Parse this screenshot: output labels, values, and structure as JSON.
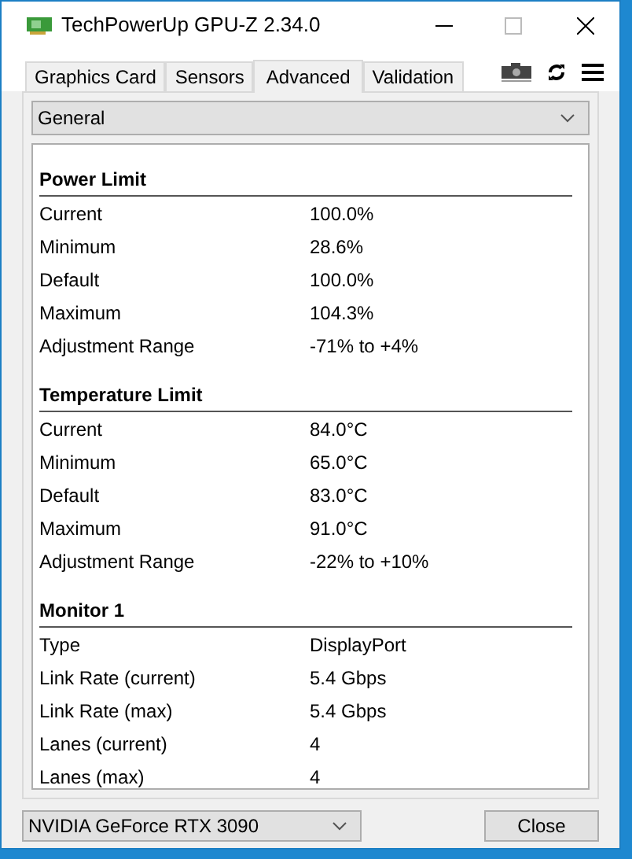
{
  "window": {
    "title": "TechPowerUp GPU-Z 2.34.0"
  },
  "tabs": [
    {
      "label": "Graphics Card",
      "selected": false
    },
    {
      "label": "Sensors",
      "selected": false
    },
    {
      "label": "Advanced",
      "selected": true
    },
    {
      "label": "Validation",
      "selected": false
    }
  ],
  "category_select": {
    "value": "General"
  },
  "sections": [
    {
      "title": "Power Limit",
      "rows": [
        [
          "Current",
          "100.0%"
        ],
        [
          "Minimum",
          "28.6%"
        ],
        [
          "Default",
          "100.0%"
        ],
        [
          "Maximum",
          "104.3%"
        ],
        [
          "Adjustment Range",
          "-71% to +4%"
        ]
      ]
    },
    {
      "title": "Temperature Limit",
      "rows": [
        [
          "Current",
          "84.0°C"
        ],
        [
          "Minimum",
          "65.0°C"
        ],
        [
          "Default",
          "83.0°C"
        ],
        [
          "Maximum",
          "91.0°C"
        ],
        [
          "Adjustment Range",
          "-22% to +10%"
        ]
      ]
    },
    {
      "title": "Monitor 1",
      "rows": [
        [
          "Type",
          "DisplayPort"
        ],
        [
          "Link Rate (current)",
          "5.4 Gbps"
        ],
        [
          "Link Rate (max)",
          "5.4 Gbps"
        ],
        [
          "Lanes (current)",
          "4"
        ],
        [
          "Lanes (max)",
          "4"
        ]
      ]
    }
  ],
  "gpu_select": {
    "value": "NVIDIA GeForce RTX 3090"
  },
  "close_button": "Close"
}
